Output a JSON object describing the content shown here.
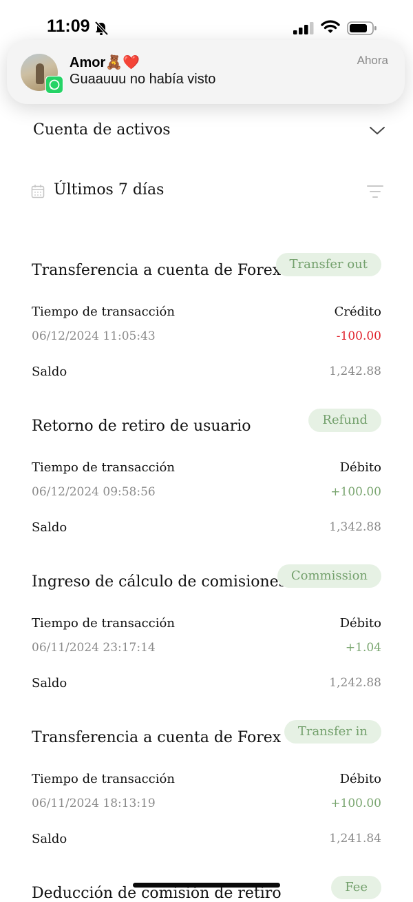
{
  "status": {
    "time": "11:09"
  },
  "notification": {
    "title": "Amor🧸❤️",
    "message": "Guaauuu no había visto",
    "time": "Ahora",
    "app_icon": "whatsapp-icon"
  },
  "account": {
    "title": "Cuenta de activos"
  },
  "date_filter": {
    "label": "Últimos 7 días"
  },
  "transactions": [
    {
      "title": "Transferencia a cuenta de Forex",
      "badge": "Transfer out",
      "time_label": "Tiempo de transacción",
      "type": "Crédito",
      "datetime": "06/12/2024 11:05:43",
      "amount": "-100.00",
      "balance_label": "Saldo",
      "balance": "1,242.88"
    },
    {
      "title": "Retorno de retiro de usuario",
      "badge": "Refund",
      "time_label": "Tiempo de transacción",
      "type": "Débito",
      "datetime": "06/12/2024 09:58:56",
      "amount": "+100.00",
      "balance_label": "Saldo",
      "balance": "1,342.88"
    },
    {
      "title": "Ingreso de cálculo de comisiones",
      "badge": "Commission",
      "time_label": "Tiempo de transacción",
      "type": "Débito",
      "datetime": "06/11/2024 23:17:14",
      "amount": "+1.04",
      "balance_label": "Saldo",
      "balance": "1,242.88"
    },
    {
      "title": "Transferencia a cuenta de Forex",
      "badge": "Transfer in",
      "time_label": "Tiempo de transacción",
      "type": "Débito",
      "datetime": "06/11/2024 18:13:19",
      "amount": "+100.00",
      "balance_label": "Saldo",
      "balance": "1,241.84"
    },
    {
      "title": "Deducción de comisión de retiro",
      "badge": "Fee"
    }
  ],
  "colors": {
    "negative": "#e0202a",
    "positive": "#79a56f",
    "badge_bg": "#e6f1e4",
    "badge_text": "#73a06c"
  }
}
